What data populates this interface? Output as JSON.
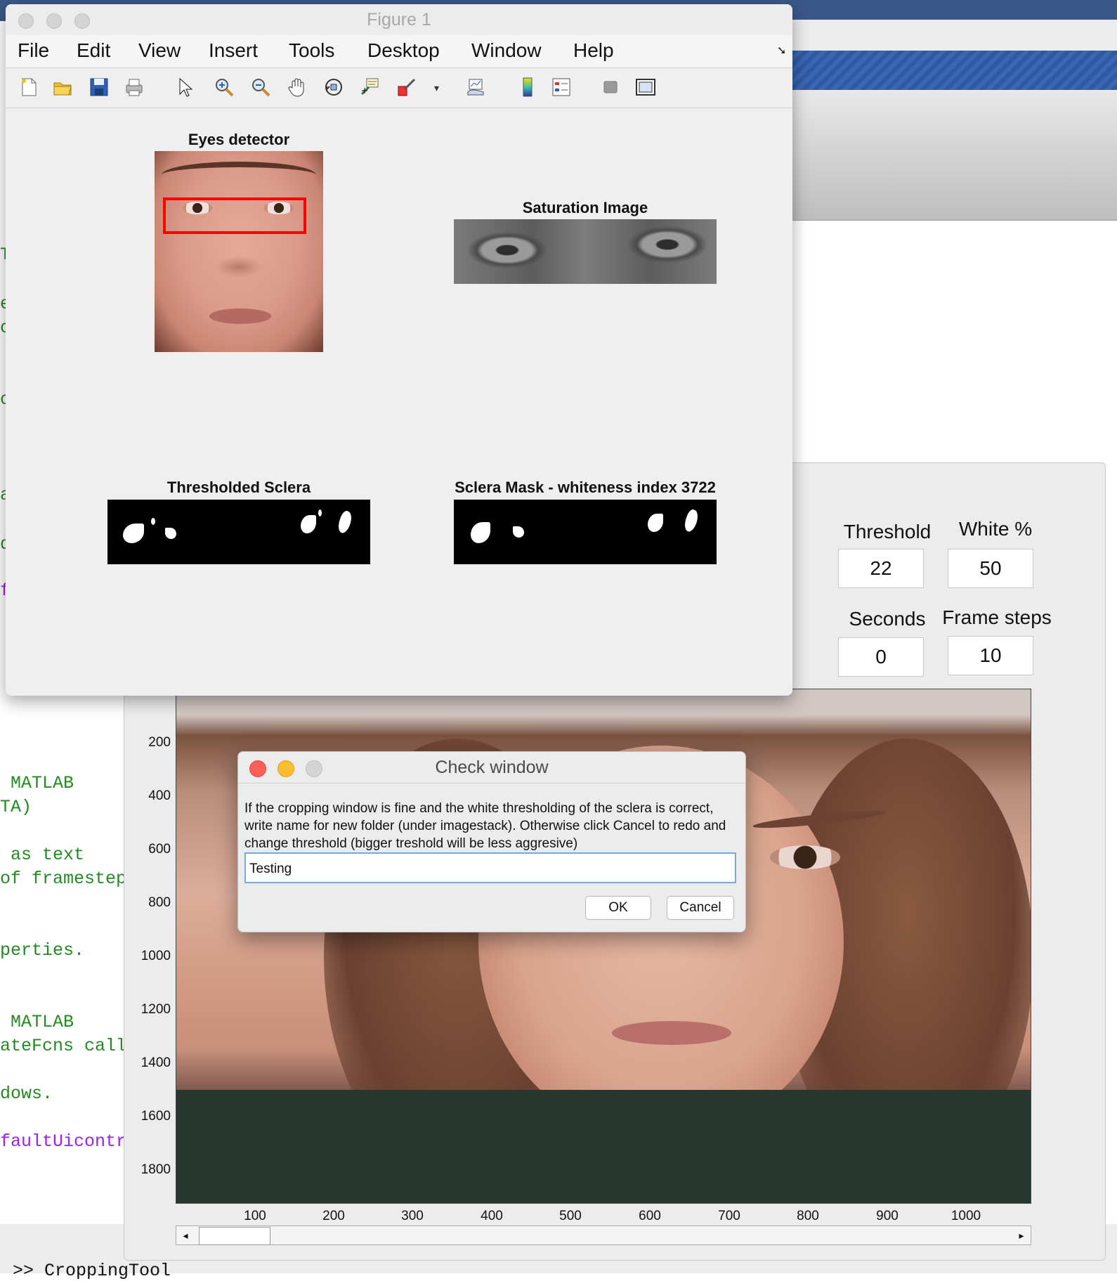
{
  "figure_window": {
    "title": "Figure 1",
    "menu": [
      "File",
      "Edit",
      "View",
      "Insert",
      "Tools",
      "Desktop",
      "Window",
      "Help"
    ],
    "toolbar_icons": [
      "new-figure-icon",
      "open-file-icon",
      "save-icon",
      "print-icon",
      "pointer-icon",
      "zoom-in-icon",
      "zoom-out-icon",
      "pan-hand-icon",
      "rotate-3d-icon",
      "data-cursor-icon",
      "brush-icon",
      "dropdown-arrow-icon",
      "link-plot-icon",
      "colorbar-icon",
      "legend-icon",
      "hide-plot-tools-icon",
      "show-plot-tools-icon"
    ],
    "subplots": {
      "eyes_detector_title": "Eyes detector",
      "saturation_title": "Saturation Image",
      "thresholded_title": "Thresholded Sclera",
      "mask_title": "Sclera Mask - whiteness index 3722"
    }
  },
  "cropping_tool": {
    "threshold_label": "Threshold",
    "threshold_value": "22",
    "white_label": "White %",
    "white_value": "50",
    "seconds_label": "Seconds",
    "seconds_value": "0",
    "frame_steps_label": "Frame steps",
    "frame_steps_value": "10",
    "y_ticks": [
      "200",
      "400",
      "600",
      "800",
      "1000",
      "1200",
      "1400",
      "1600",
      "1800"
    ],
    "x_ticks": [
      "100",
      "200",
      "300",
      "400",
      "500",
      "600",
      "700",
      "800",
      "900",
      "1000"
    ]
  },
  "editor_code_fragments": [
    {
      "text": "T",
      "color": "green"
    },
    {
      "text": "e",
      "color": "green"
    },
    {
      "text": "o",
      "color": "green"
    },
    {
      "text": "o",
      "color": "green"
    },
    {
      "text": "a",
      "color": "green"
    },
    {
      "text": "d",
      "color": "green"
    },
    {
      "text": "f",
      "color": "purple"
    },
    {
      "text": " MATLAB",
      "color": "green"
    },
    {
      "text": "TA)",
      "color": "green"
    },
    {
      "text": " as text",
      "color": "green"
    },
    {
      "text": "of framestep",
      "color": "green"
    },
    {
      "text": "perties.",
      "color": "green"
    },
    {
      "text": " MATLAB",
      "color": "green"
    },
    {
      "text": "ateFcns call",
      "color": "green"
    },
    {
      "text": "dows.",
      "color": "green"
    },
    {
      "text": "faultUicontr",
      "color": "purple"
    }
  ],
  "command_line": ">> CroppingTool",
  "dialog": {
    "title": "Check window",
    "message": "If the cropping window is fine and the white thresholding of the sclera is correct, write name for new folder (under imagestack). Otherwise click Cancel to redo and change threshold (bigger treshold will be less aggresive)",
    "input_value": "Testing",
    "ok_label": "OK",
    "cancel_label": "Cancel"
  },
  "colors": {
    "detector_box": "#ff0000",
    "close_dot": "#ff5f57",
    "minimize_dot": "#febc2e",
    "editor_green": "#228b22",
    "editor_purple": "#a020f0"
  }
}
